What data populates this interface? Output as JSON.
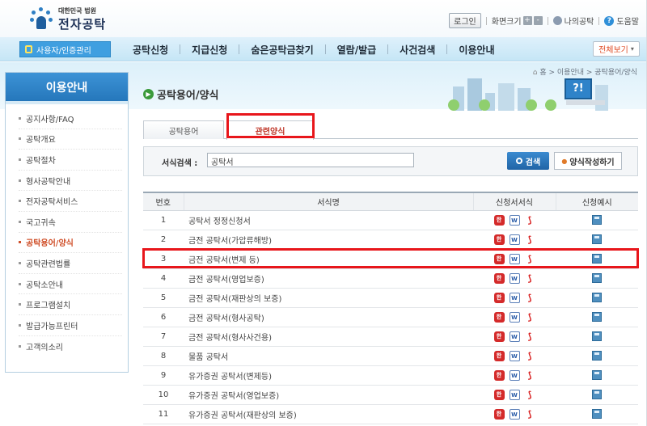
{
  "header": {
    "logo_sub": "대한민국 법원",
    "logo_main": "전자공탁",
    "login": "로그인",
    "font_size": "화면크기",
    "font_plus": "+",
    "font_minus": "-",
    "my_deposit": "나의공탁",
    "help": "도움말"
  },
  "nav": {
    "user_button": "사용자/인증관리",
    "items": [
      "공탁신청",
      "지급신청",
      "숨은공탁금찾기",
      "열람/발급",
      "사건검색",
      "이용안내"
    ],
    "view_all": "전체보기"
  },
  "breadcrumb": "홈 > 이용안내 > 공탁용어/양식",
  "sidebar": {
    "title": "이용안내",
    "items": [
      {
        "label": "공지사항/FAQ"
      },
      {
        "label": "공탁개요"
      },
      {
        "label": "공탁절차"
      },
      {
        "label": "형사공탁안내"
      },
      {
        "label": "전자공탁서비스"
      },
      {
        "label": "국고귀속"
      },
      {
        "label": "공탁용어/양식",
        "active": true
      },
      {
        "label": "공탁관련법률"
      },
      {
        "label": "공탁소안내"
      },
      {
        "label": "프로그램설치"
      },
      {
        "label": "발급가능프린터"
      },
      {
        "label": "고객의소리"
      }
    ]
  },
  "page_title": "공탁용어/양식",
  "tabs": [
    "공탁용어",
    "관련양식"
  ],
  "search": {
    "label": "서식검색 :",
    "value": "공탁서",
    "button": "검색",
    "write_button": "양식작성하기"
  },
  "table": {
    "headers": [
      "번호",
      "서식명",
      "신청서서식",
      "신청예시"
    ],
    "file_icons": [
      "hwp-icon",
      "word-icon",
      "pdf-icon"
    ],
    "rows": [
      {
        "no": "1",
        "name": "공탁서 정정신청서"
      },
      {
        "no": "2",
        "name": "금전 공탁서(가압류해방)"
      },
      {
        "no": "3",
        "name": "금전 공탁서(변제 등)"
      },
      {
        "no": "4",
        "name": "금전 공탁서(영업보증)"
      },
      {
        "no": "5",
        "name": "금전 공탁서(재판상의 보증)"
      },
      {
        "no": "6",
        "name": "금전 공탁서(형사공탁)"
      },
      {
        "no": "7",
        "name": "금전 공탁서(형사사건용)"
      },
      {
        "no": "8",
        "name": "물품 공탁서"
      },
      {
        "no": "9",
        "name": "유가증권 공탁서(변제등)"
      },
      {
        "no": "10",
        "name": "유가증권 공탁서(영업보증)"
      },
      {
        "no": "11",
        "name": "유가증권 공탁서(재판상의 보증)"
      }
    ]
  },
  "colors": {
    "accent": "#2577bb",
    "highlight": "#e8161b",
    "active": "#d0502a"
  }
}
